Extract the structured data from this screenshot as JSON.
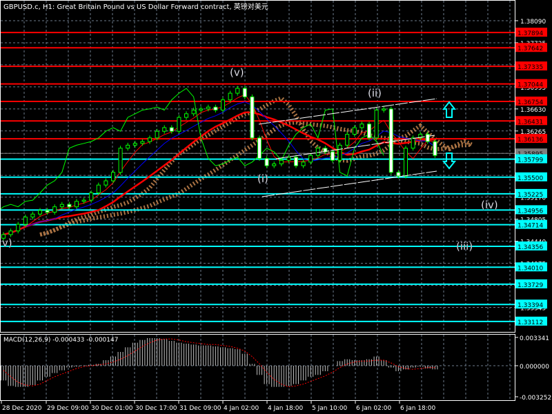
{
  "title": "GBPUSD.c, H1:  Great Britain Pound vs US Dollar Forward contract, 英镑对美元",
  "colors": {
    "background": "#000000",
    "bull": "#00ff00",
    "bear": "#ffffff",
    "resistance": "#ff0000",
    "support": "#00ffff",
    "current": "#808080",
    "grid": "#6e7b8b",
    "cloud": "#f4a460",
    "macd_signal": "#ff0000",
    "macd_hist": "#c0c0c0"
  },
  "chart_data": [
    {
      "type": "candlestick",
      "symbol": "GBPUSD.c",
      "timeframe": "H1",
      "ylim": [
        1.3296,
        1.384
      ],
      "price_ticks": [
        "1.38090",
        "1.37725",
        "1.37360",
        "1.36995",
        "1.36630",
        "1.36265",
        "1.35895",
        "1.35530",
        "1.35170",
        "1.34805",
        "1.34440",
        "1.34075",
        "1.33710",
        "1.33345"
      ],
      "resistance_levels": [
        "1.37894",
        "1.37642",
        "1.37335",
        "1.37044",
        "1.36754",
        "1.36431",
        "1.36136"
      ],
      "current_price": "1.35895",
      "support_levels": [
        "1.35799",
        "1.35500",
        "1.35225",
        "1.34956",
        "1.34714",
        "1.34356",
        "1.34010",
        "1.33729",
        "1.33394",
        "1.33112"
      ],
      "x_labels": [
        "28 Dec 2020",
        "29 Dec 09:00",
        "30 Dec 01:00",
        "30 Dec 17:00",
        "31 Dec 09:00",
        "4 Jan 02:00",
        "4 Jan 18:00",
        "5 Jan 10:00",
        "6 Jan 02:00",
        "6 Jan 18:00"
      ],
      "closes": [
        1.3455,
        1.3461,
        1.3472,
        1.3484,
        1.3489,
        1.3495,
        1.3492,
        1.3501,
        1.3505,
        1.3501,
        1.351,
        1.3512,
        1.3524,
        1.3537,
        1.3544,
        1.3558,
        1.3598,
        1.3603,
        1.3606,
        1.3609,
        1.3615,
        1.3626,
        1.3632,
        1.3626,
        1.3649,
        1.3655,
        1.3661,
        1.3663,
        1.3666,
        1.3661,
        1.3678,
        1.3689,
        1.3697,
        1.3683,
        1.3615,
        1.3581,
        1.3569,
        1.3572,
        1.3578,
        1.3583,
        1.3569,
        1.3575,
        1.3586,
        1.3598,
        1.3592,
        1.3578,
        1.3603,
        1.3621,
        1.3632,
        1.3638,
        1.3615,
        1.3661,
        1.3663,
        1.3558,
        1.3552,
        1.3598,
        1.3615,
        1.3621,
        1.3609,
        1.3586
      ],
      "wave_labels": [
        "v)",
        "(v)",
        "(i)",
        "(ii)",
        "(iii)",
        "(iv)"
      ]
    },
    {
      "type": "bar",
      "title": "MACD(12,26,9) -0.000433 -0.000147",
      "ylim": [
        -0.003252,
        0.003341
      ],
      "y_ticks": [
        "0.003341",
        "0.000000",
        "-0.003252"
      ],
      "histogram_x1000": [
        -1.6,
        -2.2,
        -2.3,
        -2.3,
        -2.1,
        -1.6,
        -1.2,
        -0.8,
        -0.5,
        -0.2,
        -0.1,
        0.05,
        0.1,
        0.2,
        0.6,
        1.0,
        1.5,
        2.0,
        2.5,
        2.8,
        3.0,
        3.0,
        2.9,
        2.7,
        2.5,
        2.4,
        2.3,
        2.2,
        2.2,
        2.1,
        2.0,
        1.9,
        1.8,
        1.3,
        0.2,
        -1.0,
        -2.0,
        -2.3,
        -2.3,
        -2.2,
        -2.0,
        -1.6,
        -1.2,
        -1.0,
        -0.6,
        0.0,
        0.5,
        0.7,
        0.6,
        0.6,
        0.7,
        1.0,
        0.6,
        -0.2,
        -0.6,
        -0.4,
        -0.2,
        -0.1,
        -0.3,
        -0.4
      ],
      "signal_x1000": [
        -0.5,
        -1.2,
        -1.8,
        -2.1,
        -2.2,
        -2.0,
        -1.6,
        -1.2,
        -0.9,
        -0.6,
        -0.3,
        -0.1,
        0.0,
        0.1,
        0.2,
        0.4,
        0.7,
        1.1,
        1.6,
        2.1,
        2.5,
        2.8,
        2.9,
        2.9,
        2.8,
        2.6,
        2.5,
        2.4,
        2.3,
        2.3,
        2.2,
        2.1,
        1.9,
        1.6,
        1.0,
        0.2,
        -0.7,
        -1.5,
        -2.0,
        -2.3,
        -2.2,
        -2.0,
        -1.7,
        -1.4,
        -1.1,
        -0.7,
        -0.2,
        0.2,
        0.4,
        0.5,
        0.5,
        0.6,
        0.6,
        0.3,
        -0.1,
        -0.3,
        -0.4,
        -0.3,
        -0.2,
        -0.2
      ]
    }
  ]
}
